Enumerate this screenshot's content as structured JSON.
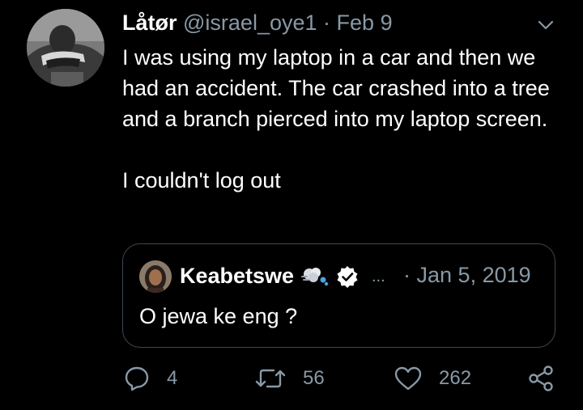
{
  "tweet": {
    "author_name": "Låtør",
    "handle": "@israel_oye1",
    "separator": "·",
    "date": "Feb 9",
    "text_paragraphs": [
      "I was using my laptop in a car and then we had an accident. The car crashed into a tree and a branch pierced into my laptop screen.",
      "I couldn't log out"
    ]
  },
  "quoted_tweet": {
    "author_name": "Keabetswe",
    "ellipsis": "...",
    "separator": "·",
    "date": "Jan 5, 2019",
    "text": "O jewa ke eng ?"
  },
  "actions": {
    "reply_count": "4",
    "retweet_count": "56",
    "like_count": "262"
  },
  "icons": {
    "menu": "chevron-down-icon",
    "reply": "reply-icon",
    "retweet": "retweet-icon",
    "like": "heart-icon",
    "share": "share-icon",
    "verified": "verified-badge-icon",
    "emoji": "dash-emoji-icon"
  },
  "colors": {
    "background": "#000000",
    "text": "#ffffff",
    "secondary": "#8899a6",
    "border": "#3d4853"
  }
}
